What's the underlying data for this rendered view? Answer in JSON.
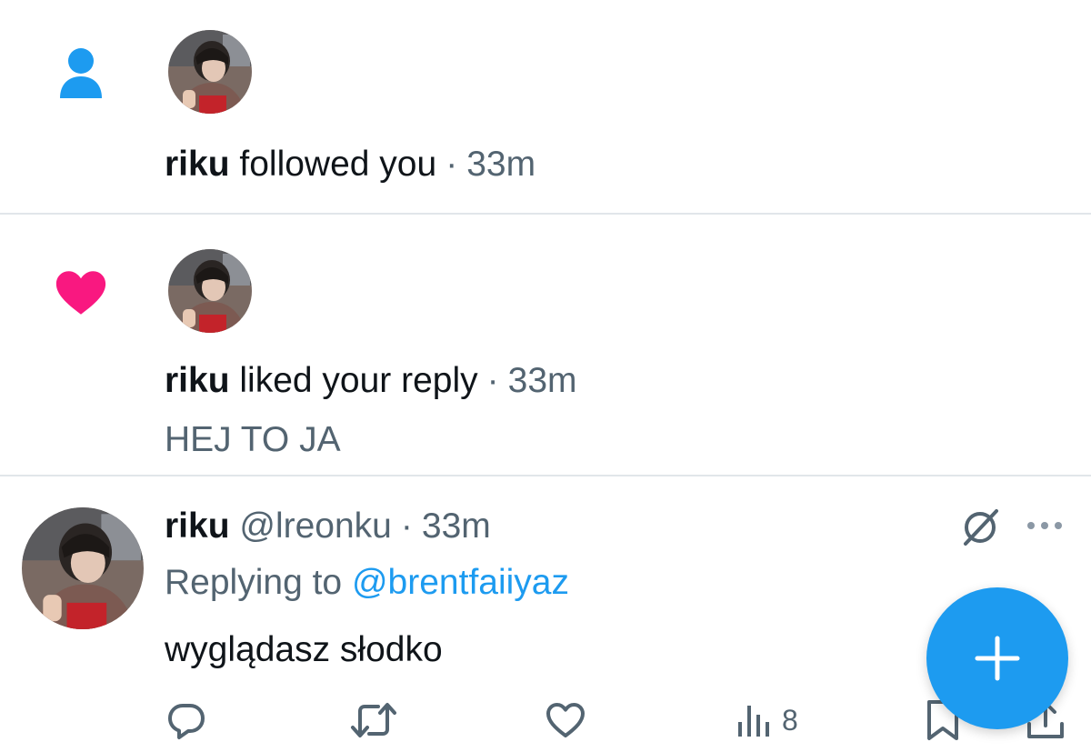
{
  "notifications": [
    {
      "type": "follow",
      "icon": "person-icon",
      "user": "riku",
      "action_text": "followed you",
      "separator": "·",
      "time": "33m"
    },
    {
      "type": "like",
      "icon": "heart-icon",
      "user": "riku",
      "action_text": "liked your reply",
      "separator": "·",
      "time": "33m",
      "preview": "HEJ TO JA"
    }
  ],
  "tweet": {
    "display_name": "riku",
    "handle": "@lreonku",
    "separator": "·",
    "time": "33m",
    "replying_prefix": "Replying to",
    "replying_to": "@brentfaiiyaz",
    "text": "wyglądasz słodko",
    "actions": {
      "reply_icon": "reply-icon",
      "retweet_icon": "retweet-icon",
      "like_icon": "like-icon",
      "views_icon": "views-icon",
      "views_count": "8",
      "bookmark_icon": "bookmark-icon",
      "share_icon": "share-icon"
    }
  },
  "fab": {
    "icon": "plus-icon"
  },
  "colors": {
    "accent": "#1d9bf0",
    "like": "#f91880",
    "muted": "#536471",
    "text": "#0f1419",
    "divider": "#e1e6ea"
  }
}
